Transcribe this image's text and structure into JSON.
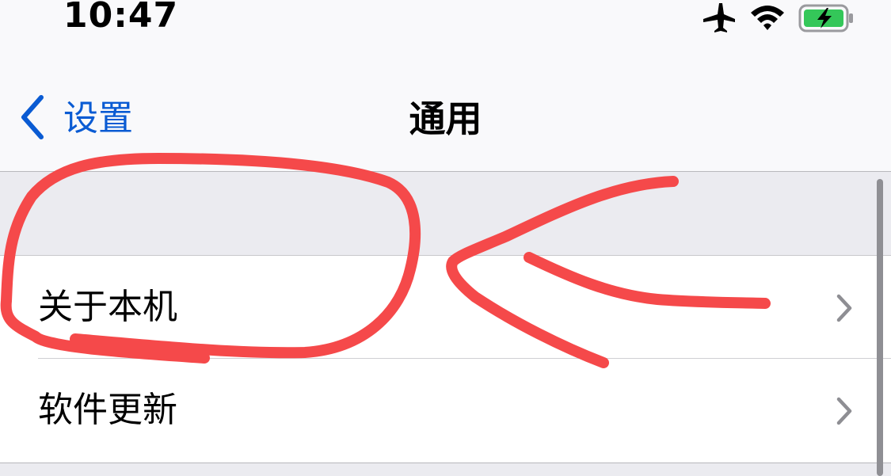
{
  "status_bar": {
    "time": "10:47",
    "icons": [
      "airplane-icon",
      "wifi-icon",
      "battery-charging-icon"
    ],
    "battery_color": "#34c759"
  },
  "nav": {
    "back_label": "设置",
    "title": "通用",
    "accent_color": "#0a5bd3"
  },
  "list": {
    "items": [
      {
        "label": "关于本机",
        "icon": "chevron-right-icon"
      },
      {
        "label": "软件更新",
        "icon": "chevron-right-icon"
      }
    ]
  },
  "annotation": {
    "color": "#f5494a",
    "shapes": [
      "circle-annotation",
      "arrow-annotation"
    ]
  }
}
